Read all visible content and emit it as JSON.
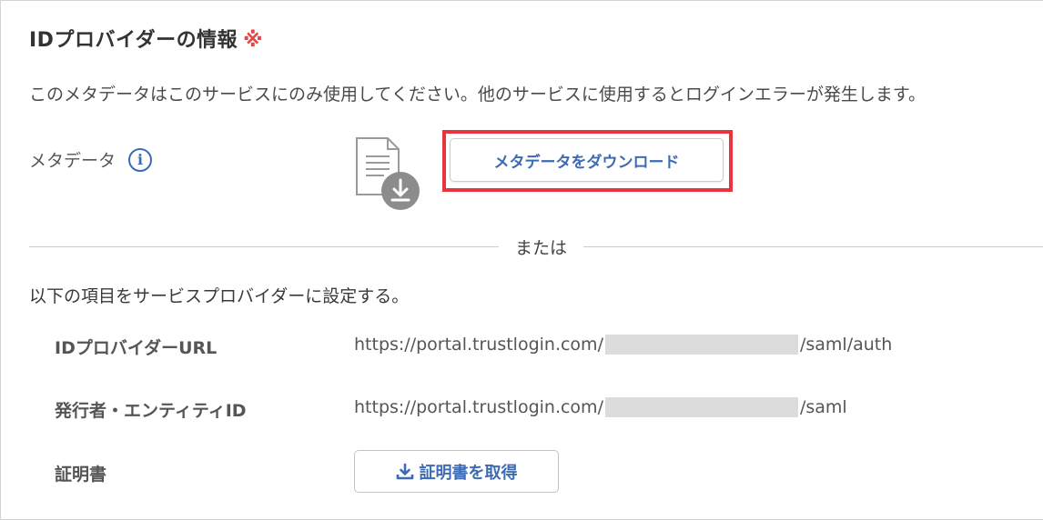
{
  "section": {
    "title": "IDプロバイダーの情報",
    "required_mark": "※"
  },
  "notice": "このメタデータはこのサービスにのみ使用してください。他のサービスに使用するとログインエラーが発生します。",
  "metadata": {
    "label": "メタデータ",
    "info_icon": "i",
    "download_button_label": "メタデータをダウンロード",
    "file_icon": "document-download-icon"
  },
  "divider_text": "または",
  "sp_instruction": "以下の項目をサービスプロバイダーに設定する。",
  "fields": {
    "idp_url": {
      "label": "IDプロバイダーURL",
      "value_prefix": "https://portal.trustlogin.com/",
      "value_suffix": "/saml/auth"
    },
    "issuer": {
      "label": "発行者・エンティティID",
      "value_prefix": "https://portal.trustlogin.com/",
      "value_suffix": "/saml"
    },
    "certificate": {
      "label": "証明書",
      "button_label": "証明書を取得"
    }
  },
  "colors": {
    "accent_blue": "#3d6bb3",
    "highlight_red": "#e8343f",
    "required_red": "#e04848"
  }
}
